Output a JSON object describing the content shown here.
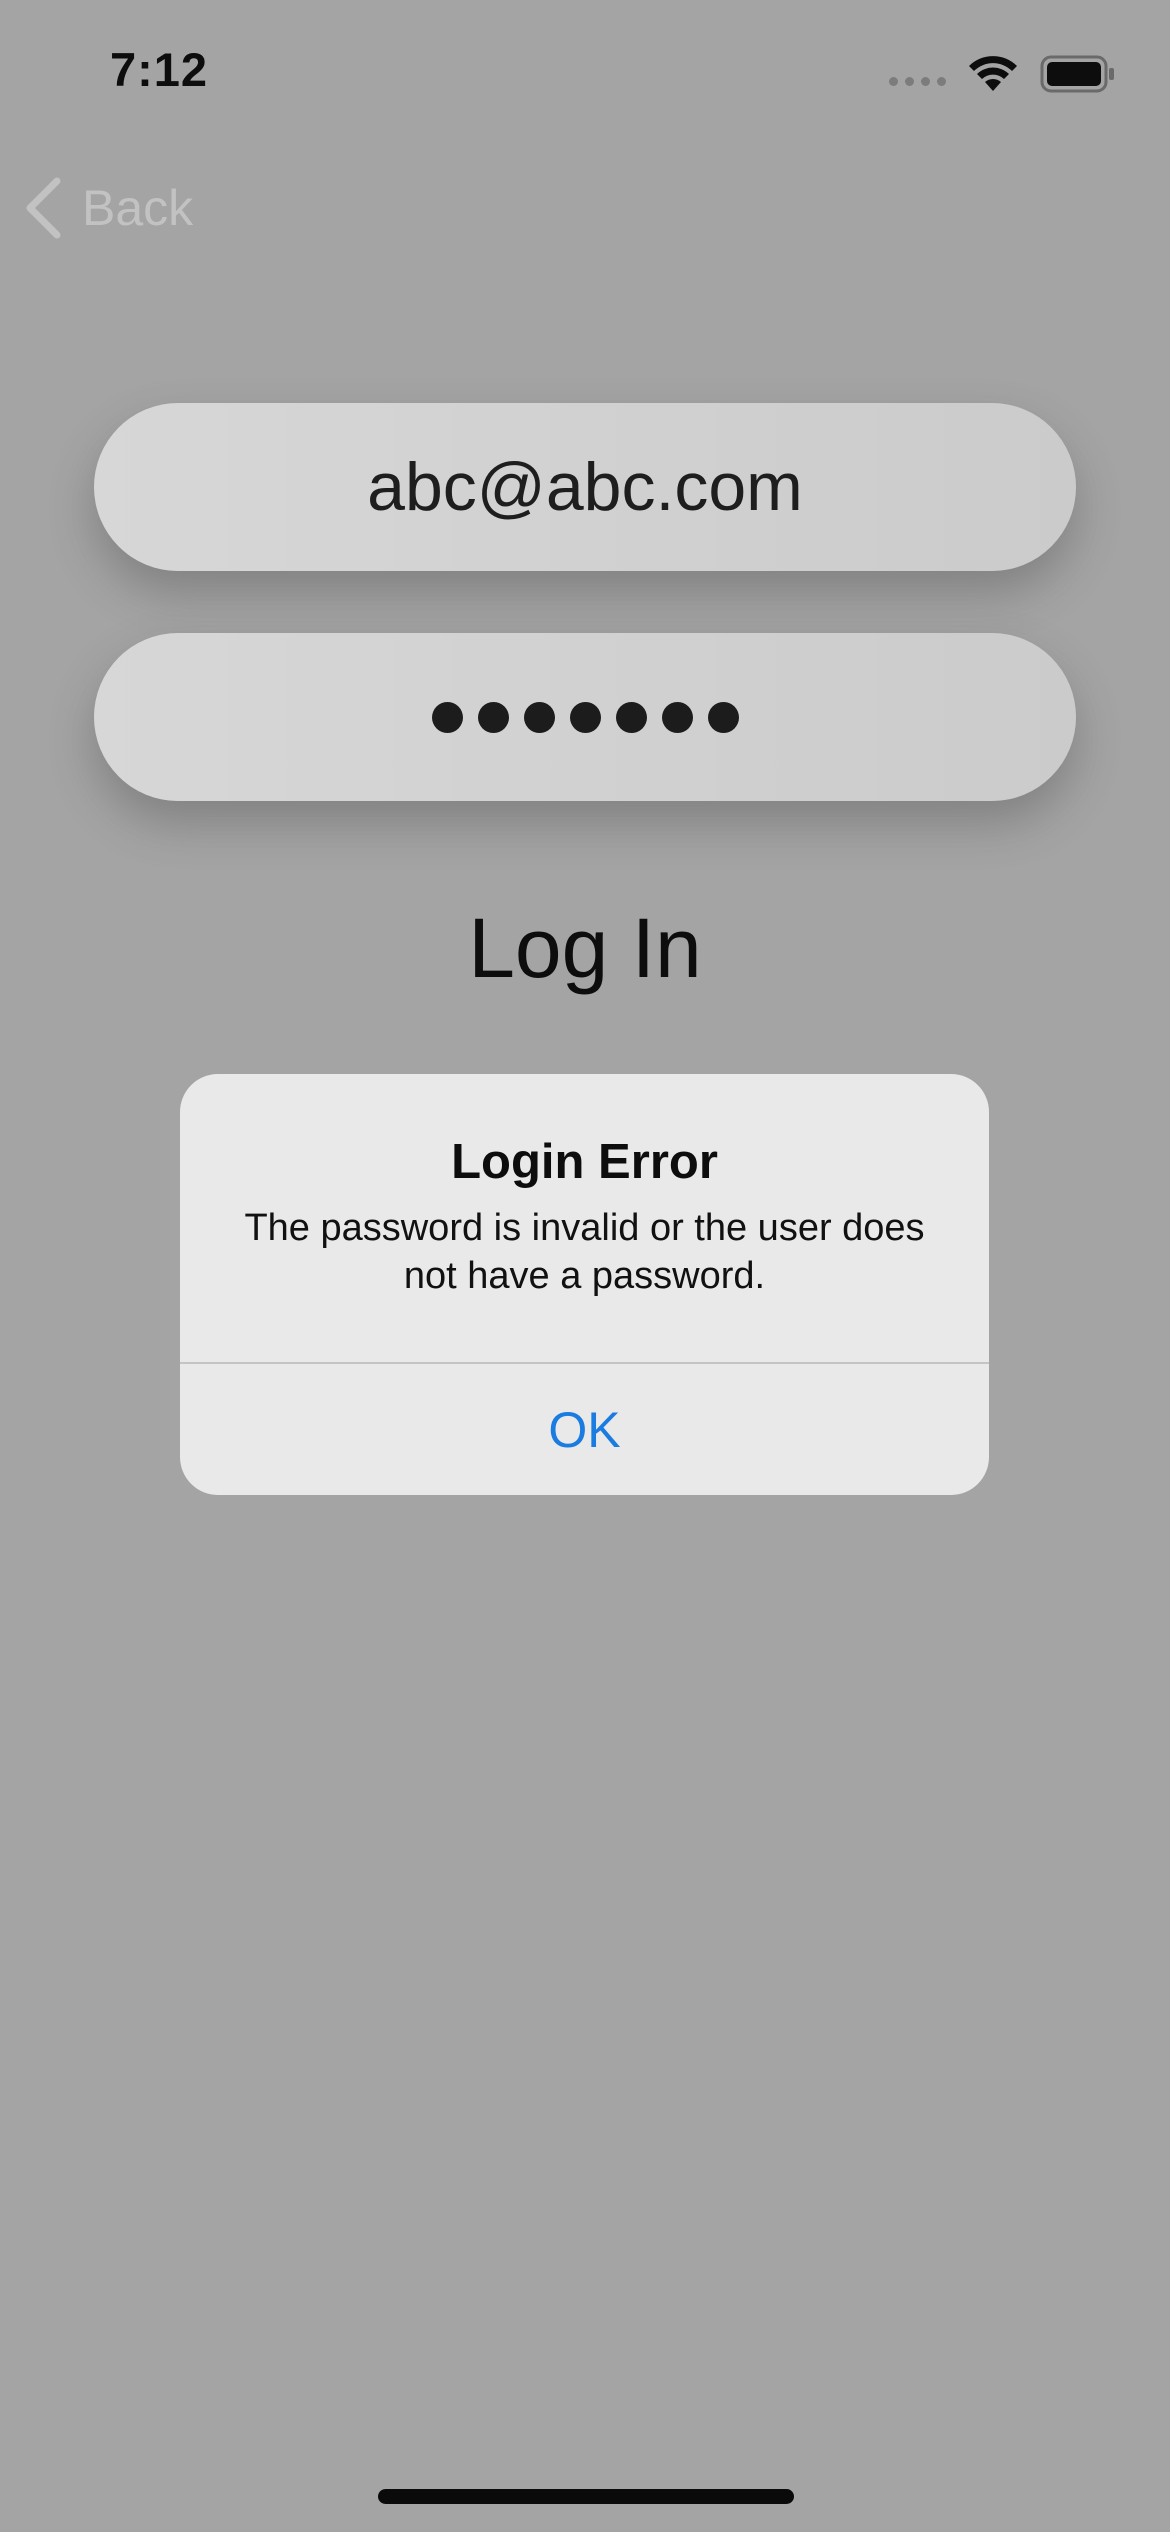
{
  "status_bar": {
    "time": "7:12"
  },
  "nav": {
    "back_label": "Back"
  },
  "form": {
    "email_value": "abc@abc.com",
    "password_masked": "●●●●●●●",
    "password_length": 7,
    "login_label": "Log In"
  },
  "alert": {
    "title": "Login Error",
    "message": "The password is invalid or the user does not have a password.",
    "ok_label": "OK"
  },
  "colors": {
    "background_dimmed": "#a4a4a4",
    "alert_background": "#e9e9e9",
    "accent_blue": "#1a7ce0"
  },
  "icons": {
    "back": "chevron-left-icon",
    "cellular": "cellular-signal-icon",
    "wifi": "wifi-icon",
    "battery": "battery-icon"
  }
}
